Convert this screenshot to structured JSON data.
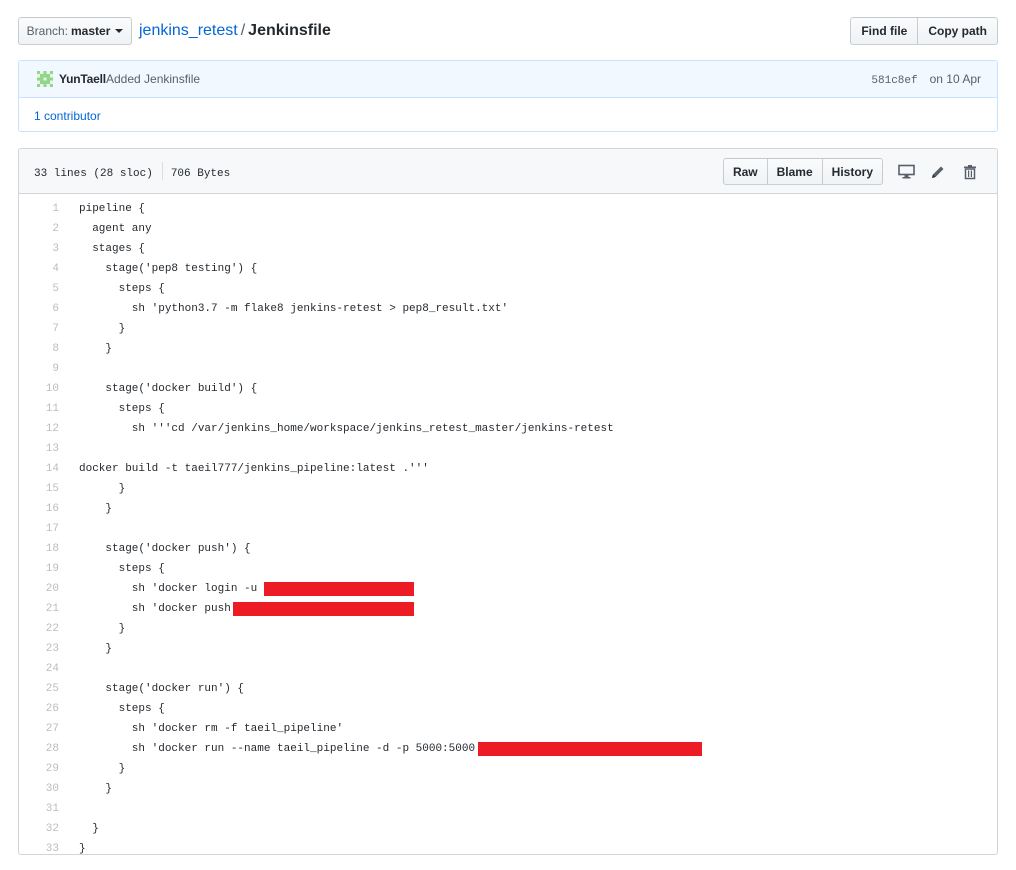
{
  "topbar": {
    "branch_label": "Branch:",
    "branch_value": "master",
    "repo": "jenkins_retest",
    "separator": "/",
    "file": "Jenkinsfile",
    "find_file": "Find file",
    "copy_path": "Copy path"
  },
  "commit": {
    "author": "YunTaell",
    "message": "Added Jenkinsfile",
    "sha": "581c8ef",
    "date": "on 10 Apr",
    "contributors": "1 contributor"
  },
  "file": {
    "lines_info": "33 lines (28 sloc)",
    "size": "706 Bytes",
    "raw": "Raw",
    "blame": "Blame",
    "history": "History"
  },
  "colors": {
    "link": "#0366d6",
    "redaction": "#ed1c24",
    "avatar": "#8ed887"
  },
  "icons": [
    "desktop-icon",
    "pencil-icon",
    "trash-icon",
    "caret-down-icon"
  ],
  "code_lines": [
    "pipeline {",
    "  agent any",
    "  stages {",
    "    stage('pep8 testing') {",
    "      steps {",
    "        sh 'python3.7 -m flake8 jenkins-retest > pep8_result.txt'",
    "      }",
    "    }",
    "",
    "    stage('docker build') {",
    "      steps {",
    "        sh '''cd /var/jenkins_home/workspace/jenkins_retest_master/jenkins-retest",
    "",
    "docker build -t taeil777/jenkins_pipeline:latest .'''",
    "      }",
    "    }",
    "",
    "    stage('docker push') {",
    "      steps {",
    "        sh 'docker login -u ",
    "        sh 'docker push",
    "      }",
    "    }",
    "",
    "    stage('docker run') {",
    "      steps {",
    "        sh 'docker rm -f taeil_pipeline'",
    "        sh 'docker run --name taeil_pipeline -d -p 5000:5000",
    "      }",
    "    }",
    "",
    "  }",
    "}"
  ]
}
